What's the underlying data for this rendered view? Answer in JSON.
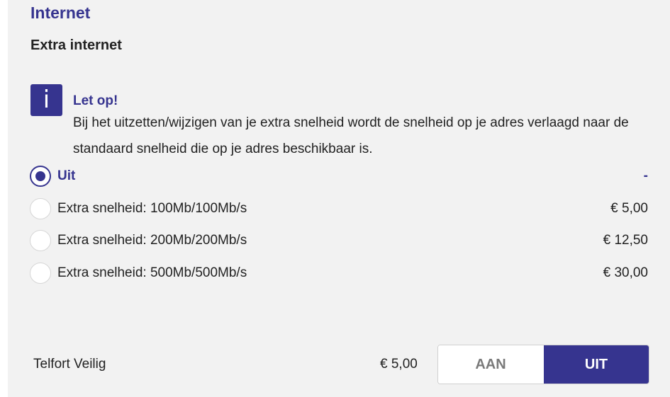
{
  "section": {
    "title": "Internet",
    "subtitle": "Extra internet"
  },
  "notice": {
    "icon": "info-icon",
    "icon_glyph": "i",
    "title": "Let op!",
    "body": "Bij het uitzetten/wijzigen van je extra snelheid wordt de snelheid op je adres verlaagd naar de standaard snelheid die op je adres beschikbaar is."
  },
  "options": [
    {
      "label": "Uit",
      "price": "-",
      "selected": true
    },
    {
      "label": "Extra snelheid: 100Mb/100Mb/s",
      "price": "€ 5,00",
      "selected": false
    },
    {
      "label": "Extra snelheid: 200Mb/200Mb/s",
      "price": "€ 12,50",
      "selected": false
    },
    {
      "label": "Extra snelheid: 500Mb/500Mb/s",
      "price": "€ 30,00",
      "selected": false
    }
  ],
  "telfort_veilig": {
    "label": "Telfort Veilig",
    "price": "€ 5,00",
    "toggle_on_label": "AAN",
    "toggle_off_label": "UIT",
    "state": "UIT"
  },
  "colors": {
    "accent": "#36348f",
    "panel_bg": "#f2f2f2",
    "text": "#222222"
  }
}
